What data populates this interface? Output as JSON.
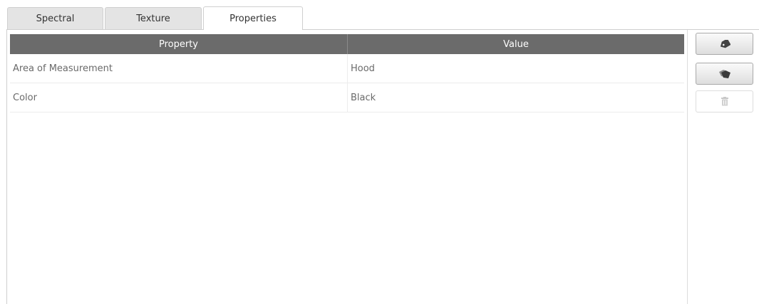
{
  "tabs": [
    {
      "label": "Spectral",
      "active": false
    },
    {
      "label": "Texture",
      "active": false
    },
    {
      "label": "Properties",
      "active": true
    }
  ],
  "table": {
    "columns": [
      "Property",
      "Value"
    ],
    "rows": [
      {
        "property": "Area of Measurement",
        "value": "Hood"
      },
      {
        "property": "Color",
        "value": "Black"
      }
    ]
  },
  "side_buttons": [
    {
      "icon": "tag-icon",
      "enabled": true
    },
    {
      "icon": "tags-icon",
      "enabled": true
    },
    {
      "icon": "trash-icon",
      "enabled": false
    }
  ],
  "colors": {
    "header_bg": "#6b6b6b",
    "header_text": "#ffffff",
    "cell_text": "#6a6a6a",
    "tab_inactive_bg": "#e4e4e4"
  }
}
